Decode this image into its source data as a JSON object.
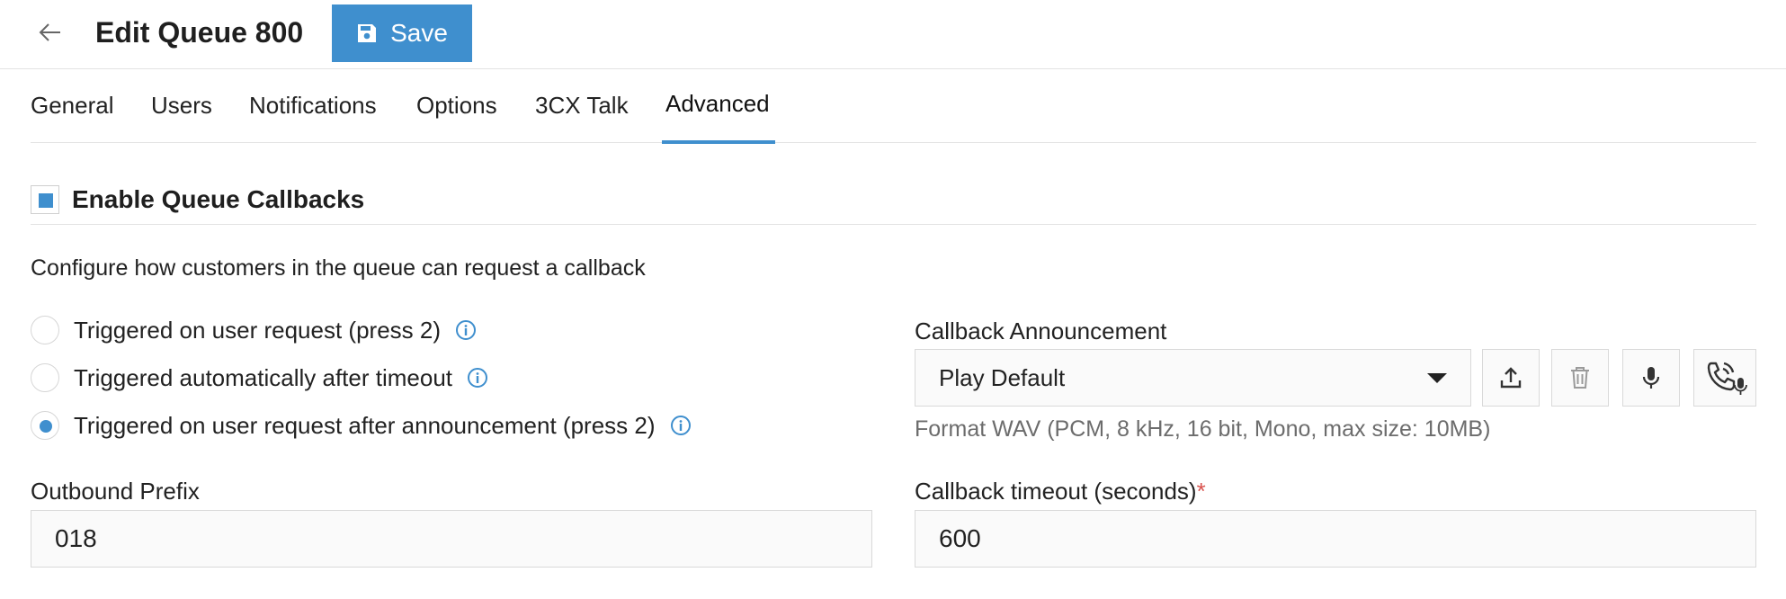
{
  "header": {
    "title": "Edit Queue 800",
    "save_label": "Save"
  },
  "tabs": [
    {
      "label": "General"
    },
    {
      "label": "Users"
    },
    {
      "label": "Notifications"
    },
    {
      "label": "Options"
    },
    {
      "label": "3CX Talk"
    },
    {
      "label": "Advanced",
      "active": true
    }
  ],
  "callbacks": {
    "enable_label": "Enable Queue Callbacks",
    "enabled": true,
    "description": "Configure how customers in the queue can request a callback",
    "options": [
      {
        "label": "Triggered on user request (press 2)",
        "selected": false
      },
      {
        "label": "Triggered automatically after timeout",
        "selected": false
      },
      {
        "label": "Triggered on user request after announcement (press 2)",
        "selected": true
      }
    ]
  },
  "announcement": {
    "label": "Callback Announcement",
    "selected": "Play Default",
    "hint": "Format WAV (PCM, 8 kHz, 16 bit, Mono, max size: 10MB)"
  },
  "outbound_prefix": {
    "label": "Outbound Prefix",
    "value": "018"
  },
  "callback_timeout": {
    "label": "Callback timeout (seconds)",
    "required_mark": "*",
    "value": "600"
  },
  "colors": {
    "accent": "#3f8fce",
    "required": "#d9534f"
  },
  "icons": {
    "back": "arrow-left-icon",
    "save": "floppy-disk-icon",
    "info": "info-circle-icon",
    "upload": "upload-icon",
    "delete": "trash-icon",
    "record": "microphone-icon",
    "record_by_phone": "phone-microphone-icon"
  }
}
